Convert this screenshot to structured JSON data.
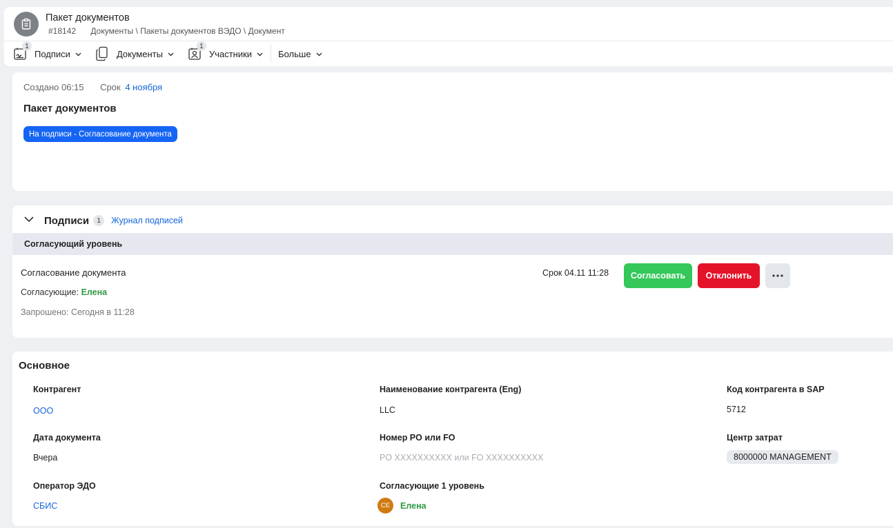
{
  "header": {
    "title": "Пакет документов",
    "number": "#18142",
    "breadcrumb": "Документы \\ Пакеты документов ВЭДО \\ Документ",
    "avatar_icon": "clipboard-icon"
  },
  "toolbar": {
    "items": [
      {
        "label": "Подписи",
        "badge": "1",
        "icon": "signature-icon"
      },
      {
        "label": "Документы",
        "icon": "documents-icon"
      },
      {
        "label": "Участники",
        "badge": "1",
        "icon": "participants-icon"
      },
      {
        "label": "Больше"
      }
    ]
  },
  "info": {
    "created_label": "Создано 06:15",
    "due_label": "Срок",
    "due_value": "4 ноября",
    "title": "Пакет документов",
    "status": "На подписи - Согласование документа",
    "status_color": "#1565f5"
  },
  "signatures": {
    "title": "Подписи",
    "count": "1",
    "journal_link": "Журнал подписей",
    "level": "Согласующий уровень",
    "item": {
      "name": "Согласование документа",
      "approvers_label": "Согласующие:",
      "approver": "Елена",
      "requested": "Запрошено: Сегодня в 11:28",
      "due": "Срок 04.11 11:28"
    },
    "buttons": {
      "approve": "Согласовать",
      "reject": "Отклонить",
      "more": "···"
    },
    "colors": {
      "approve": "#34c759",
      "reject": "#e5132a"
    }
  },
  "main": {
    "title": "Основное",
    "fields": {
      "counterparty": {
        "label": "Контрагент",
        "value": "ООО"
      },
      "counterparty_eng": {
        "label": "Наименование контрагента (Eng)",
        "value": "LLC"
      },
      "sap_code": {
        "label": "Код контрагента в SAP",
        "value": "5712"
      },
      "doc_date": {
        "label": "Дата документа",
        "value": "Вчера"
      },
      "po_number": {
        "label": "Номер PO или FO",
        "placeholder": "PO XXXXXXXXXX или FO XXXXXXXXXX"
      },
      "cost_center": {
        "label": "Центр затрат",
        "value": "8000000 MANAGEMENT"
      },
      "edo_operator": {
        "label": "Оператор ЭДО",
        "value": "СБИС"
      },
      "approvers_l1": {
        "label": "Согласующие 1 уровень",
        "initials": "СЕ",
        "name": "Елена"
      }
    }
  }
}
